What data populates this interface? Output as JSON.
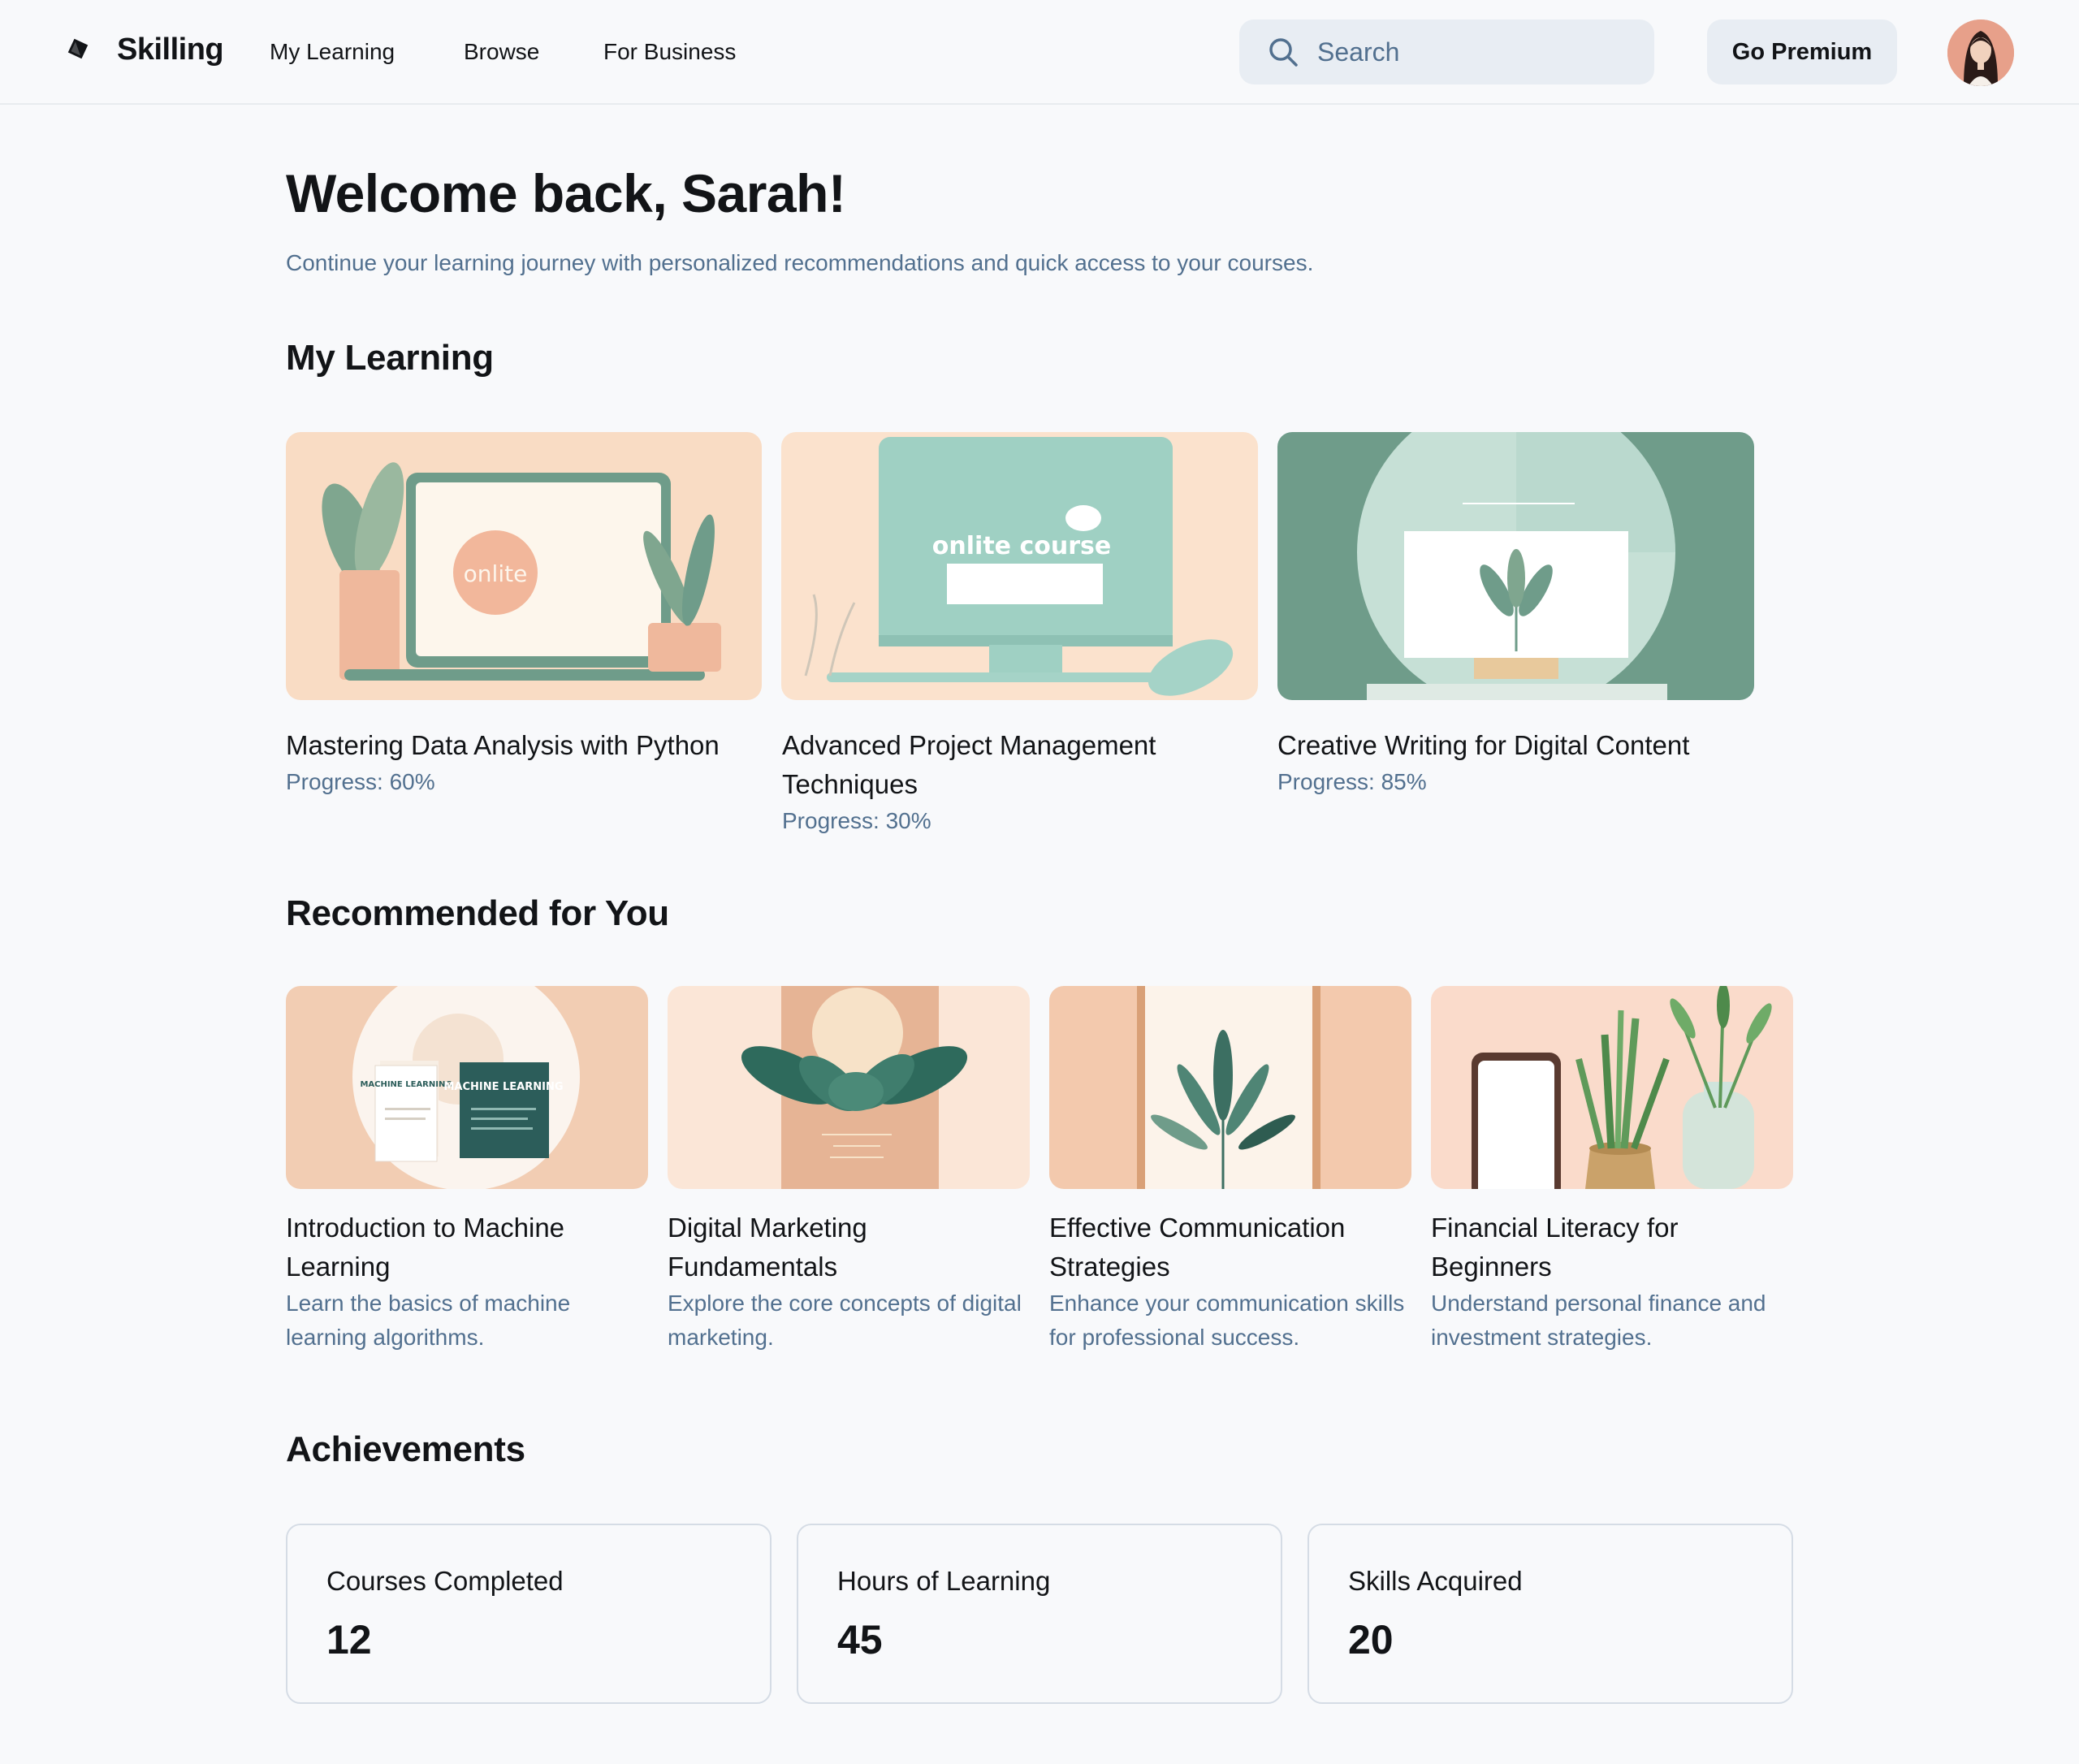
{
  "header": {
    "brand": "Skilling",
    "nav": [
      "My Learning",
      "Browse",
      "For Business"
    ],
    "search_placeholder": "Search",
    "premium_label": "Go Premium"
  },
  "welcome": {
    "title": "Welcome back, Sarah!",
    "subtitle": "Continue your learning journey with personalized recommendations and quick access to your courses."
  },
  "my_learning": {
    "title": "My Learning",
    "courses": [
      {
        "title": "Mastering Data Analysis with Python",
        "progress": "Progress: 60%",
        "thumb_text": "onlite"
      },
      {
        "title": "Advanced Project Management Techniques",
        "progress": "Progress: 30%",
        "thumb_text": "onlite course"
      },
      {
        "title": "Creative Writing for Digital Content",
        "progress": "Progress: 85%"
      }
    ]
  },
  "recommended": {
    "title": "Recommended for You",
    "courses": [
      {
        "title": "Introduction to Machine Learning",
        "desc": "Learn the basics of machine learning algorithms.",
        "thumb_text": "MACHINE LEARNING"
      },
      {
        "title": "Digital Marketing Fundamentals",
        "desc": "Explore the core concepts of digital marketing."
      },
      {
        "title": "Effective Communication Strategies",
        "desc": "Enhance your communication skills for professional success."
      },
      {
        "title": "Financial Literacy for Beginners",
        "desc": "Understand personal finance and investment strategies."
      }
    ]
  },
  "achievements": {
    "title": "Achievements",
    "items": [
      {
        "label": "Courses Completed",
        "value": "12"
      },
      {
        "label": "Hours of Learning",
        "value": "45"
      },
      {
        "label": "Skills Acquired",
        "value": "20"
      }
    ]
  },
  "colors": {
    "background": "#f8f9fb",
    "text": "#121417",
    "muted": "#52708f",
    "surface": "#e8edf3",
    "peach": "#f7d9c3",
    "sage": "#6f9c8a"
  },
  "icons": [
    "logo-icon",
    "search-icon",
    "avatar"
  ]
}
